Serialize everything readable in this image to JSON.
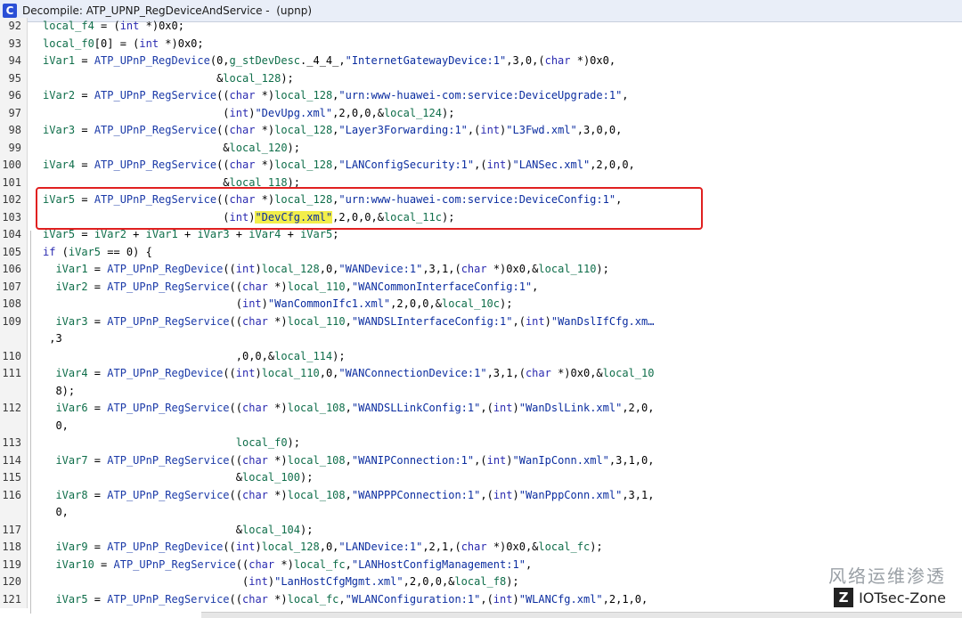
{
  "window": {
    "icon_glyph": "C",
    "title": "Decompile: ATP_UPNP_RegDeviceAndService -  (upnp)"
  },
  "watermark": {
    "chinese": "风络运维渗透",
    "brand": "IOTsec-Zone",
    "logo_glyph": "Z"
  },
  "code_lines": [
    {
      "n": "92",
      "t": "local_f4 = (int *)0x0;"
    },
    {
      "n": "93",
      "t": "local_f0[0] = (int *)0x0;"
    },
    {
      "n": "94",
      "t": "iVar1 = ATP_UPnP_RegDevice(0,g_stDevDesc._4_4_,\"InternetGatewayDevice:1\",3,0,(char *)0x0,"
    },
    {
      "n": "95",
      "t": "                           &local_128);"
    },
    {
      "n": "96",
      "t": "iVar2 = ATP_UPnP_RegService((char *)local_128,\"urn:www-huawei-com:service:DeviceUpgrade:1\","
    },
    {
      "n": "97",
      "t": "                            (int)\"DevUpg.xml\",2,0,0,&local_124);"
    },
    {
      "n": "98",
      "t": "iVar3 = ATP_UPnP_RegService((char *)local_128,\"Layer3Forwarding:1\",(int)\"L3Fwd.xml\",3,0,0,"
    },
    {
      "n": "99",
      "t": "                            &local_120);"
    },
    {
      "n": "100",
      "t": "iVar4 = ATP_UPnP_RegService((char *)local_128,\"LANConfigSecurity:1\",(int)\"LANSec.xml\",2,0,0,"
    },
    {
      "n": "101",
      "t": "                            &local_118);"
    },
    {
      "n": "102",
      "t": "iVar5 = ATP_UPnP_RegService((char *)local_128,\"urn:www-huawei-com:service:DeviceConfig:1\","
    },
    {
      "n": "103",
      "t": "                            (int)\"DevCfg.xml\",2,0,0,&local_11c);"
    },
    {
      "n": "104",
      "t": "iVar5 = iVar2 + iVar1 + iVar3 + iVar4 + iVar5;"
    },
    {
      "n": "105",
      "t": "if (iVar5 == 0) {"
    },
    {
      "n": "106",
      "t": "  iVar1 = ATP_UPnP_RegDevice((int)local_128,0,\"WANDevice:1\",3,1,(char *)0x0,&local_110);"
    },
    {
      "n": "107",
      "t": "  iVar2 = ATP_UPnP_RegService((char *)local_110,\"WANCommonInterfaceConfig:1\","
    },
    {
      "n": "108",
      "t": "                              (int)\"WanCommonIfc1.xml\",2,0,0,&local_10c);"
    },
    {
      "n": "109",
      "t": "  iVar3 = ATP_UPnP_RegService((char *)local_110,\"WANDSLInterfaceConfig:1\",(int)\"WanDslIfCfg.xm…"
    },
    {
      "n": "",
      "t": " ,3"
    },
    {
      "n": "110",
      "t": "                              ,0,0,&local_114);"
    },
    {
      "n": "111",
      "t": "  iVar4 = ATP_UPnP_RegDevice((int)local_110,0,\"WANConnectionDevice:1\",3,1,(char *)0x0,&local_10"
    },
    {
      "n": "",
      "t": "  8);"
    },
    {
      "n": "112",
      "t": "  iVar6 = ATP_UPnP_RegService((char *)local_108,\"WANDSLLinkConfig:1\",(int)\"WanDslLink.xml\",2,0,"
    },
    {
      "n": "",
      "t": "  0,"
    },
    {
      "n": "113",
      "t": "                              local_f0);"
    },
    {
      "n": "114",
      "t": "  iVar7 = ATP_UPnP_RegService((char *)local_108,\"WANIPConnection:1\",(int)\"WanIpConn.xml\",3,1,0,"
    },
    {
      "n": "115",
      "t": "                              &local_100);"
    },
    {
      "n": "116",
      "t": "  iVar8 = ATP_UPnP_RegService((char *)local_108,\"WANPPPConnection:1\",(int)\"WanPppConn.xml\",3,1,"
    },
    {
      "n": "",
      "t": "  0,"
    },
    {
      "n": "117",
      "t": "                              &local_104);"
    },
    {
      "n": "118",
      "t": "  iVar9 = ATP_UPnP_RegDevice((int)local_128,0,\"LANDevice:1\",2,1,(char *)0x0,&local_fc);"
    },
    {
      "n": "119",
      "t": "  iVar10 = ATP_UPnP_RegService((char *)local_fc,\"LANHostConfigManagement:1\","
    },
    {
      "n": "120",
      "t": "                               (int)\"LanHostCfgMgmt.xml\",2,0,0,&local_f8);"
    },
    {
      "n": "121",
      "t": "  iVar5 = ATP_UPnP_RegService((char *)local_fc,\"WLANConfiguration:1\",(int)\"WLANCfg.xml\",2,1,0,"
    }
  ]
}
